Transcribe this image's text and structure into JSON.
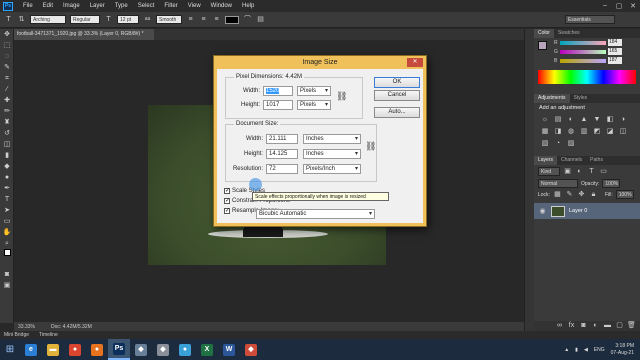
{
  "app": {
    "logo": "Ps",
    "menu": [
      "File",
      "Edit",
      "Image",
      "Layer",
      "Type",
      "Select",
      "Filter",
      "View",
      "Window",
      "Help"
    ],
    "window_controls": [
      "–",
      "▢",
      "✕"
    ]
  },
  "options_bar": {
    "font_family": "Arching",
    "font_style": "Regular",
    "font_size": "12 pt",
    "aa_label": "aa",
    "aa_mode": "Smooth",
    "workspace": "Essentials"
  },
  "document": {
    "tab_title": "football-3471371_1920.jpg @ 33.3% (Layer 0, RGB/8#) *",
    "zoom": "33.33%",
    "doc_info": "Doc: 4.42M/5.32M"
  },
  "bottom_tabs": [
    "Mini Bridge",
    "Timeline"
  ],
  "color_panel": {
    "tabs": [
      "Color",
      "Swatches"
    ],
    "rows": [
      {
        "label": "R",
        "value": "184"
      },
      {
        "label": "G",
        "value": "165"
      },
      {
        "label": "B",
        "value": "187"
      }
    ]
  },
  "adjustments_panel": {
    "tabs": [
      "Adjustments",
      "Styles"
    ],
    "heading": "Add an adjustment",
    "icons": [
      "☼",
      "▤",
      "◐",
      "▲",
      "▼",
      "◧",
      "◑",
      "▦",
      "◨",
      "◍",
      "▥",
      "◩",
      "◪",
      "◫",
      "▧",
      "◔",
      "▨"
    ]
  },
  "layers_panel": {
    "tabs": [
      "Layers",
      "Channels",
      "Paths"
    ],
    "kind": "Kind",
    "blend_mode": "Normal",
    "opacity_label": "Opacity:",
    "opacity_value": "100%",
    "lock_label": "Lock:",
    "fill_label": "Fill:",
    "fill_value": "100%",
    "layer_name": "Layer 0"
  },
  "dialog": {
    "title": "Image Size",
    "close": "✕",
    "pixel_dimensions_label": "Pixel Dimensions:",
    "pixel_dimensions_value": "4.42M",
    "width_label": "Width:",
    "width_value": "1520",
    "width_unit": "Pixels",
    "height_label": "Height:",
    "height_value": "1017",
    "height_unit": "Pixels",
    "document_size_label": "Document Size:",
    "doc_width_label": "Width:",
    "doc_width_value": "21.111",
    "doc_width_unit": "Inches",
    "doc_height_label": "Height:",
    "doc_height_value": "14.125",
    "doc_height_unit": "Inches",
    "resolution_label": "Resolution:",
    "resolution_value": "72",
    "resolution_unit": "Pixels/Inch",
    "scale_styles": "Scale Styles",
    "constrain": "Constrain Proportions",
    "resample": "Resample Image:",
    "resample_method": "Bicubic Automatic",
    "ok": "OK",
    "cancel": "Cancel",
    "auto": "Auto...",
    "tooltip": "Scale effects proportionally when image is resized"
  },
  "taskbar": {
    "apps": [
      {
        "name": "ie",
        "glyph": "e",
        "color": "#2a7fd4"
      },
      {
        "name": "explorer",
        "glyph": "▬",
        "color": "#e2b23a"
      },
      {
        "name": "chrome",
        "glyph": "●",
        "color": "#d9452f"
      },
      {
        "name": "firefox",
        "glyph": "●",
        "color": "#e8731f"
      },
      {
        "name": "photoshop",
        "glyph": "Ps",
        "color": "#0b2f5a"
      },
      {
        "name": "app6",
        "glyph": "◆",
        "color": "#6a7f98"
      },
      {
        "name": "app7",
        "glyph": "◆",
        "color": "#8b8f99"
      },
      {
        "name": "app8",
        "glyph": "●",
        "color": "#3aa0d8"
      },
      {
        "name": "excel",
        "glyph": "X",
        "color": "#1f7244"
      },
      {
        "name": "word",
        "glyph": "W",
        "color": "#2b579a"
      },
      {
        "name": "app11",
        "glyph": "◆",
        "color": "#cf4b3a"
      }
    ],
    "tray_lang": "ENG",
    "time": "3:18 PM",
    "date": "07-Aug-21"
  }
}
